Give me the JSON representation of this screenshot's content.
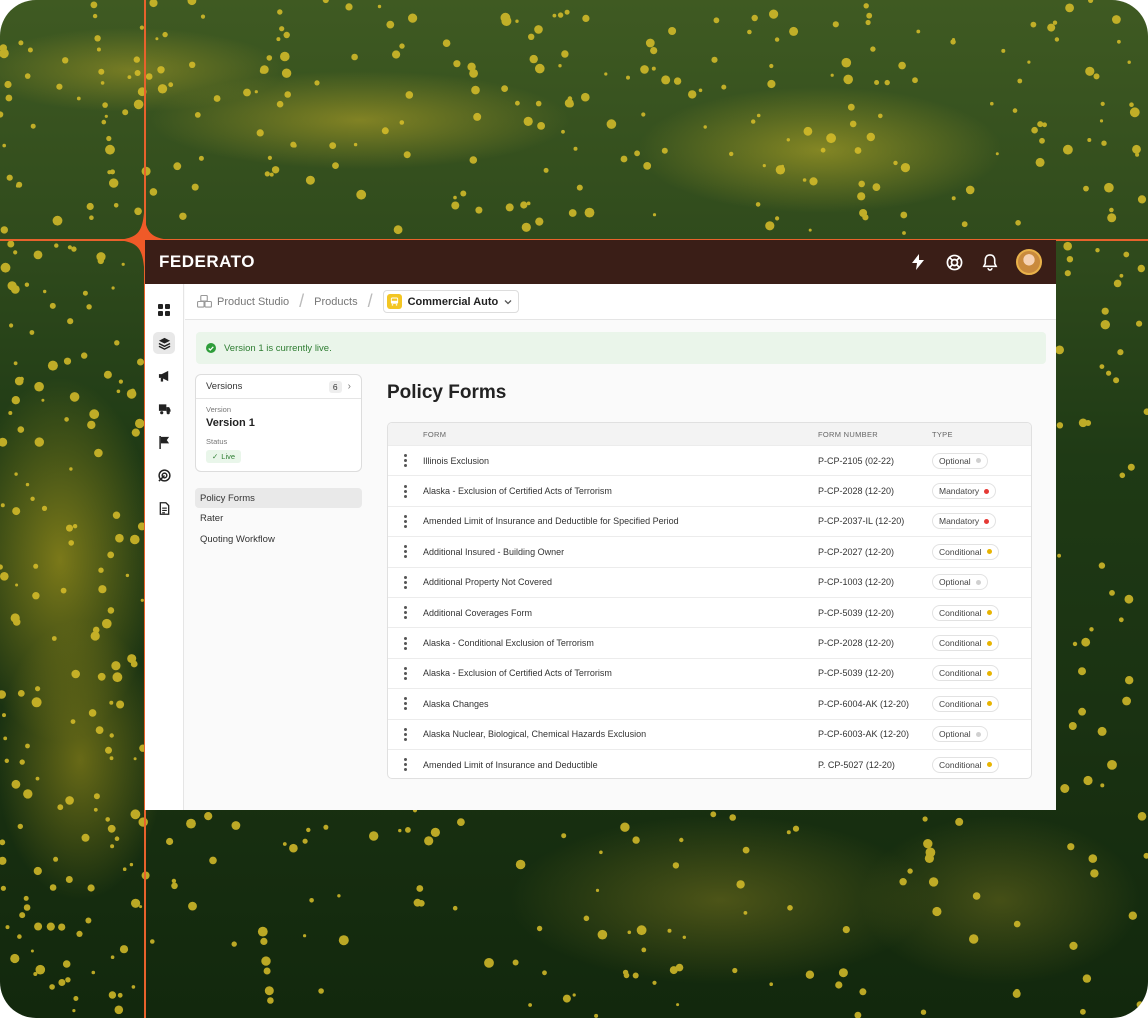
{
  "app": {
    "logo": "FEDERATO"
  },
  "header_icons": [
    "lightning-icon",
    "lifebuoy-icon",
    "bell-icon",
    "avatar"
  ],
  "breadcrumb": {
    "studio": "Product Studio",
    "products": "Products",
    "current": "Commercial Auto"
  },
  "banner": {
    "text": "Version 1 is currently live."
  },
  "versions": {
    "label": "Versions",
    "count": "6",
    "version_label": "Version",
    "version_name": "Version 1",
    "status_label": "Status",
    "status": "Live"
  },
  "nav": [
    {
      "label": "Policy Forms",
      "active": true
    },
    {
      "label": "Rater",
      "active": false
    },
    {
      "label": "Quoting Workflow",
      "active": false
    }
  ],
  "page_title": "Policy Forms",
  "table": {
    "headers": {
      "form": "FORM",
      "number": "FORM NUMBER",
      "type": "TYPE"
    },
    "rows": [
      {
        "form": "Illinois Exclusion",
        "number": "P-CP-2105 (02-22)",
        "type": "Optional"
      },
      {
        "form": "Alaska - Exclusion of Certified Acts of Terrorism",
        "number": "P-CP-2028 (12-20)",
        "type": "Mandatory"
      },
      {
        "form": "Amended Limit of Insurance and Deductible for Specified Period",
        "number": "P-CP-2037-IL (12-20)",
        "type": "Mandatory"
      },
      {
        "form": "Additional Insured - Building Owner",
        "number": "P-CP-2027 (12-20)",
        "type": "Conditional"
      },
      {
        "form": "Additional Property Not Covered",
        "number": "P-CP-1003 (12-20)",
        "type": "Optional"
      },
      {
        "form": "Additional Coverages Form",
        "number": "P-CP-5039 (12-20)",
        "type": "Conditional"
      },
      {
        "form": "Alaska - Conditional Exclusion of Terrorism",
        "number": "P-CP-2028 (12-20)",
        "type": "Conditional"
      },
      {
        "form": "Alaska - Exclusion of Certified Acts of Terrorism",
        "number": "P-CP-5039 (12-20)",
        "type": "Conditional"
      },
      {
        "form": "Alaska Changes",
        "number": "P-CP-6004-AK (12-20)",
        "type": "Conditional"
      },
      {
        "form": "Alaska Nuclear, Biological, Chemical Hazards Exclusion",
        "number": "P-CP-6003-AK (12-20)",
        "type": "Optional"
      },
      {
        "form": "Amended Limit of Insurance and Deductible",
        "number": "P. CP-5027 (12-20)",
        "type": "Conditional"
      }
    ]
  },
  "type_colors": {
    "Optional": "#d0d0d0",
    "Mandatory": "#e53935",
    "Conditional": "#e8b400"
  },
  "accent": "#e8622c",
  "topbar_color": "#3a1e17"
}
